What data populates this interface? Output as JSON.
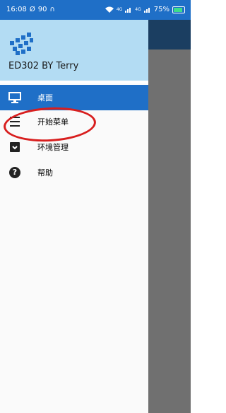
{
  "status_bar": {
    "time": "16:08",
    "left_icons": [
      "mute-icon",
      "data-speed-icon",
      "headphones-icon"
    ],
    "speed_text": "90",
    "signal_labels": [
      "4G",
      "4G"
    ],
    "battery": "75%",
    "battery_level": 0.75
  },
  "drawer": {
    "title": "ED302 BY Terry",
    "items": [
      {
        "label": "桌面",
        "icon": "monitor-icon",
        "active": true
      },
      {
        "label": "开始菜单",
        "icon": "menu-icon",
        "active": false
      },
      {
        "label": "环境管理",
        "icon": "archive-icon",
        "active": false
      },
      {
        "label": "帮助",
        "icon": "help-icon",
        "active": false
      }
    ]
  },
  "colors": {
    "accent": "#1f6fc7",
    "header_bg": "#b3dcf3",
    "appbar": "#1b3e61",
    "annotation": "#d81e1e",
    "scrim": "#707070"
  }
}
